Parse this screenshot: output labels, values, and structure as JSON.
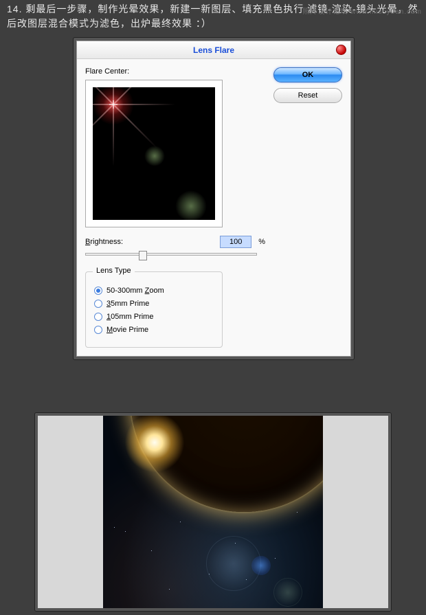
{
  "instruction": "14. 剩最后一步骤，制作光晕效果，新建一新图层、填充黑色执行 滤镜-渲染-镜头光晕，然后改图层混合模式为滤色，出炉最终效果 ：）",
  "watermark": "照片设计论坛 www.missyuan.com",
  "dialog": {
    "title": "Lens Flare",
    "flare_center_label": "Flare Center:",
    "brightness_label": "Brightness:",
    "brightness_value": "100",
    "brightness_unit": "%",
    "lens_type_legend": "Lens Type",
    "options": {
      "zoom": "50-300mm Zoom",
      "p35": "35mm Prime",
      "p105": "105mm Prime",
      "movie": "Movie Prime"
    },
    "selected": "zoom",
    "ok_label": "OK",
    "reset_label": "Reset"
  }
}
